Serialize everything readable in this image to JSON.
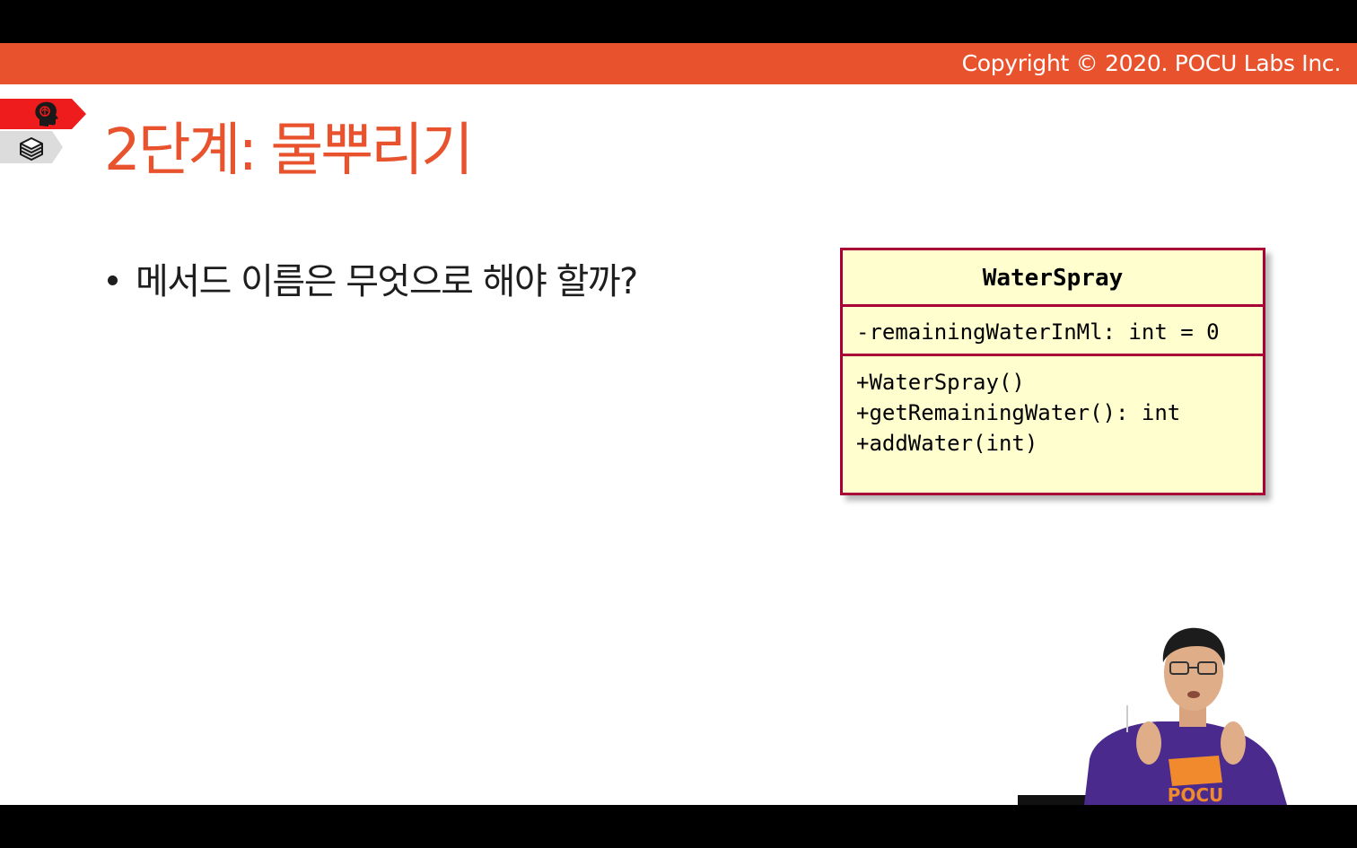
{
  "header": {
    "copyright": "Copyright © 2020. POCU Labs Inc.",
    "accent_color": "#e8532e"
  },
  "side_tags": [
    {
      "icon": "brain-head-icon",
      "color": "#ee1c1c"
    },
    {
      "icon": "stacked-books-icon",
      "color": "#dcdcdc"
    }
  ],
  "slide": {
    "title": "2단계: 물뿌리기",
    "bullets": [
      "메서드 이름은 무엇으로 해야 할까?"
    ]
  },
  "uml_class": {
    "name": "WaterSpray",
    "attributes": [
      "-remainingWaterInMl: int = 0"
    ],
    "methods": [
      "+WaterSpray()",
      "+getRemainingWater(): int",
      "+addWater(int)"
    ],
    "fill_color": "#fefece",
    "border_color": "#a80036"
  },
  "presenter": {
    "shirt_text": "POCU",
    "shirt_color": "#4a2a8c"
  }
}
